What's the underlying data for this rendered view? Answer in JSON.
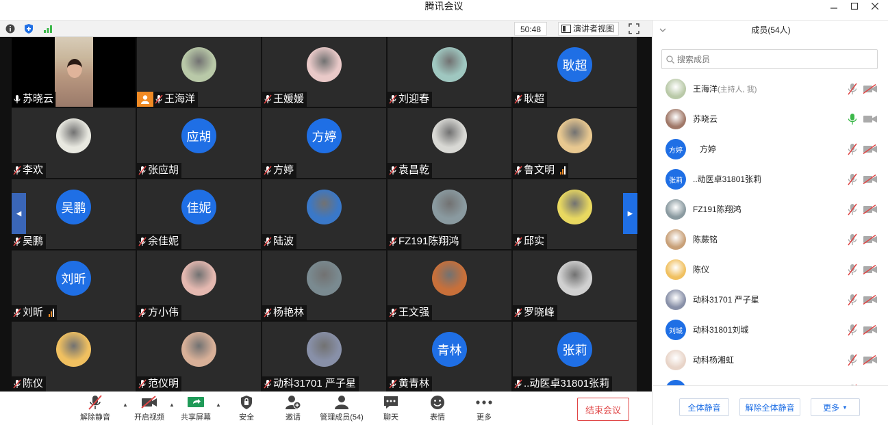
{
  "window": {
    "title": "腾讯会议"
  },
  "toolbar": {
    "timer": "50:48",
    "speaker_view": "演讲者视图"
  },
  "tiles": [
    {
      "name": "苏晓云",
      "avatar_type": "video",
      "mic": "on",
      "signal": false
    },
    {
      "name": "王海洋",
      "avatar_type": "photo",
      "photo_color": "#b9c9a8",
      "mic": "muted",
      "host": true
    },
    {
      "name": "王媛媛",
      "avatar_type": "photo",
      "photo_color": "#e9c9c8",
      "mic": "muted"
    },
    {
      "name": "刘迎春",
      "avatar_type": "photo",
      "photo_color": "#9fc7c0",
      "mic": "muted"
    },
    {
      "name": "耿超",
      "avatar_type": "text",
      "avatar_text": "耿超",
      "mic": "muted"
    },
    {
      "name": "李欢",
      "avatar_type": "photo",
      "photo_color": "#e8e8e0",
      "mic": "muted"
    },
    {
      "name": "张应胡",
      "avatar_type": "text",
      "avatar_text": "应胡",
      "mic": "muted"
    },
    {
      "name": "方婷",
      "avatar_type": "text",
      "avatar_text": "方婷",
      "mic": "muted"
    },
    {
      "name": "袁昌乾",
      "avatar_type": "photo",
      "photo_color": "#d8d8d4",
      "mic": "muted"
    },
    {
      "name": "鲁文明",
      "avatar_type": "photo",
      "photo_color": "#e8c890",
      "mic": "muted",
      "signal": true
    },
    {
      "name": "吴鹏",
      "avatar_type": "text",
      "avatar_text": "吴鹏",
      "mic": "muted"
    },
    {
      "name": "余佳妮",
      "avatar_type": "text",
      "avatar_text": "佳妮",
      "mic": "muted"
    },
    {
      "name": "陆波",
      "avatar_type": "photo",
      "photo_color": "#3a78c8",
      "mic": "muted"
    },
    {
      "name": "FZ191陈翔鸿",
      "avatar_type": "photo",
      "photo_color": "#8a9aa0",
      "mic": "muted"
    },
    {
      "name": "邱实",
      "avatar_type": "photo",
      "photo_color": "#e8d860",
      "mic": "muted"
    },
    {
      "name": "刘昕",
      "avatar_type": "text",
      "avatar_text": "刘昕",
      "mic": "muted",
      "signal": true
    },
    {
      "name": "方小伟",
      "avatar_type": "photo",
      "photo_color": "#e4b8b0",
      "mic": "muted"
    },
    {
      "name": "杨艳林",
      "avatar_type": "photo",
      "photo_color": "#7a8a90",
      "mic": "muted"
    },
    {
      "name": "王文强",
      "avatar_type": "photo",
      "photo_color": "#c8703a",
      "mic": "muted"
    },
    {
      "name": "罗晓峰",
      "avatar_type": "photo",
      "photo_color": "#d0d0d0",
      "mic": "muted"
    },
    {
      "name": "陈仪",
      "avatar_type": "photo",
      "photo_color": "#f0c060",
      "mic": "muted"
    },
    {
      "name": "范仪明",
      "avatar_type": "photo",
      "photo_color": "#d8b098",
      "mic": "muted"
    },
    {
      "name": "动科31701 严子星",
      "avatar_type": "photo",
      "photo_color": "#8890a8",
      "mic": "muted"
    },
    {
      "name": "黄青林",
      "avatar_type": "text",
      "avatar_text": "青林",
      "mic": "muted"
    },
    {
      "name": "..动医卓31801张莉",
      "avatar_type": "text",
      "avatar_text": "张莉",
      "mic": "muted"
    }
  ],
  "bottom_toolbar": {
    "unmute": "解除静音",
    "start_video": "开启视频",
    "share_screen": "共享屏幕",
    "security": "安全",
    "invite": "邀请",
    "manage_members": "管理成员(54)",
    "chat": "聊天",
    "reactions": "表情",
    "more": "更多",
    "end_meeting": "结束会议"
  },
  "panel": {
    "title": "成员(54人)",
    "search_placeholder": "搜索成员",
    "members": [
      {
        "name": "王海洋",
        "suffix": "(主持人, 我)",
        "avatar_type": "photo",
        "photo_color": "#b9c9a8",
        "mic": "muted",
        "cam": "off"
      },
      {
        "name": "苏晓云",
        "avatar_type": "photo",
        "photo_color": "#a07868",
        "mic": "on",
        "cam": "on"
      },
      {
        "name": "方婷",
        "avatar_type": "text",
        "avatar_text": "方婷",
        "mic": "muted",
        "cam": "off"
      },
      {
        "name": "..动医卓31801张莉",
        "avatar_type": "text",
        "avatar_text": "张莉",
        "mic": "muted",
        "cam": "off"
      },
      {
        "name": "FZ191陈翔鸿",
        "avatar_type": "photo",
        "photo_color": "#8a9aa0",
        "mic": "muted",
        "cam": "off"
      },
      {
        "name": "陈蕨铭",
        "avatar_type": "photo",
        "photo_color": "#c8a078",
        "mic": "muted",
        "cam": "off"
      },
      {
        "name": "陈仪",
        "avatar_type": "photo",
        "photo_color": "#f0c060",
        "mic": "muted",
        "cam": "off"
      },
      {
        "name": "动科31701 严子星",
        "avatar_type": "photo",
        "photo_color": "#8890a8",
        "mic": "muted",
        "cam": "off"
      },
      {
        "name": "动科31801刘城",
        "avatar_type": "text",
        "avatar_text": "刘城",
        "mic": "muted",
        "cam": "off"
      },
      {
        "name": "动科杨湘虹",
        "avatar_type": "photo",
        "photo_color": "#e8d4c8",
        "mic": "muted",
        "cam": "off"
      },
      {
        "name": "",
        "avatar_type": "text",
        "avatar_text": "",
        "mic": "muted",
        "cam": "off"
      }
    ],
    "mute_all": "全体静音",
    "unmute_all": "解除全体静音",
    "more": "更多"
  },
  "colors": {
    "accent": "#1f6fe5",
    "danger": "#e04545",
    "mic_on": "#3cb84a",
    "muted_red": "#e04545"
  }
}
